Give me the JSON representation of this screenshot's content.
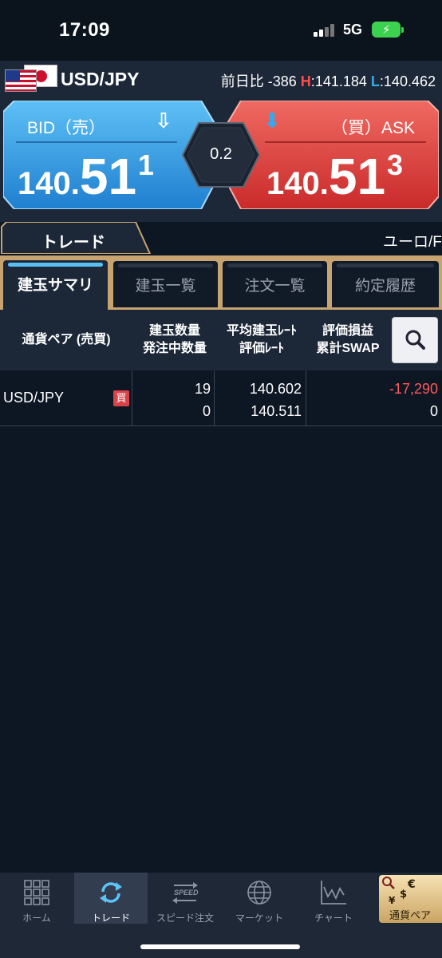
{
  "status_bar": {
    "time": "17:09",
    "network": "5G",
    "battery_color": "#3cd24f"
  },
  "header": {
    "pair": "USD/JPY",
    "change_label": "前日比",
    "change_value": "-386",
    "high_label": "H",
    "high_value": "141.184",
    "low_label": "L",
    "low_value": "140.462"
  },
  "quote": {
    "bid": {
      "label": "BID（売）",
      "rate_small": "140.",
      "rate_big": "51",
      "rate_sup": "1",
      "icon": "down-arrow-outline-icon"
    },
    "ask": {
      "label": "（買）ASK",
      "rate_small": "140.",
      "rate_big": "51",
      "rate_sup": "3",
      "icon": "down-arrow-icon"
    },
    "spread": "0.2",
    "colors": {
      "bid": "#2f9be0",
      "ask": "#d63b3b"
    }
  },
  "tabs": {
    "main": "トレード",
    "secondary": "ユーロ/F"
  },
  "subtabs": [
    "建玉サマリ",
    "建玉一覧",
    "注文一覧",
    "約定履歴"
  ],
  "table": {
    "headers": [
      [
        "通貨ペア (売買)"
      ],
      [
        "建玉数量",
        "発注中数量"
      ],
      [
        "平均建玉ﾚｰﾄ",
        "評価ﾚｰﾄ"
      ],
      [
        "評価損益",
        "累計SWAP"
      ]
    ],
    "rows": [
      {
        "pair": "USD/JPY",
        "side": "買",
        "qty": "19",
        "pending_qty": "0",
        "avg_rate": "140.602",
        "eval_rate": "140.511",
        "pnl": "-17,290",
        "swap": "0"
      }
    ],
    "pnl_negative_color": "#ff5a5a"
  },
  "nav": [
    {
      "label": "ホーム",
      "icon": "grid-icon"
    },
    {
      "label": "トレード",
      "icon": "refresh-arrows-icon"
    },
    {
      "label": "スピード注文",
      "icon": "speed-icon"
    },
    {
      "label": "マーケット",
      "icon": "globe-icon"
    },
    {
      "label": "チャート",
      "icon": "chart-icon"
    },
    {
      "label": "通貨ペア",
      "icon": "currency-icon"
    }
  ]
}
